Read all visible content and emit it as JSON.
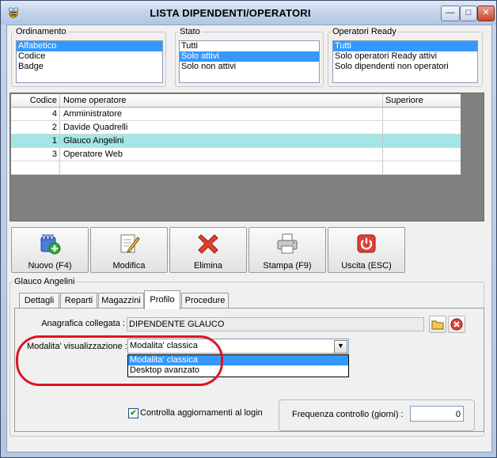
{
  "window": {
    "title": "LISTA DIPENDENTI/OPERATORI",
    "controls": {
      "minimize": "—",
      "maximize": "□",
      "close": "✕"
    }
  },
  "filters": {
    "ordinamento": {
      "label": "Ordinamento",
      "items": [
        "Alfabetico",
        "Codice",
        "Badge"
      ],
      "selected": 0
    },
    "stato": {
      "label": "Stato",
      "items": [
        "Tutti",
        "Solo attivi",
        "Solo non attivi"
      ],
      "selected": 1
    },
    "operatori_ready": {
      "label": "Operatori Ready",
      "items": [
        "Tutti",
        "Solo operatori Ready attivi",
        "Solo dipendenti non operatori"
      ],
      "selected": 0
    }
  },
  "grid": {
    "headers": [
      "Codice",
      "Nome operatore",
      "Superiore"
    ],
    "rows": [
      [
        "4",
        "Amministratore",
        ""
      ],
      [
        "2",
        "Davide Quadrelli",
        ""
      ],
      [
        "1",
        "Glauco Angelini",
        ""
      ],
      [
        "3",
        "Operatore Web",
        ""
      ],
      [
        "",
        "",
        ""
      ]
    ],
    "selected_row": 2
  },
  "toolbar": {
    "new": "Nuovo (F4)",
    "edit": "Modifica",
    "delete": "Elimina",
    "print": "Stampa (F9)",
    "exit": "Uscita (ESC)"
  },
  "detail": {
    "group_title": "Glauco Angelini",
    "tabs": [
      "Dettagli",
      "Reparti",
      "Magazzini",
      "Profilo",
      "Procedure"
    ],
    "active_tab": "Profilo",
    "anagrafica_label": "Anagrafica collegata :",
    "anagrafica_value": "DIPENDENTE GLAUCO",
    "modalita_label": "Modalita' visualizzazione :",
    "modalita_value": "Modalita' classica",
    "modalita_options": [
      "Modalita' classica",
      "Desktop avanzato"
    ],
    "modalita_selected": 0,
    "check_label": "Controlla aggiornamenti al login",
    "check_checked": true,
    "frequenza_label": "Frequenza controllo (giorni) :",
    "frequenza_value": "0"
  },
  "colors": {
    "selection": "#3399ff",
    "selected_row": "#a4e6e6",
    "highlight_oval": "#e0141e"
  }
}
